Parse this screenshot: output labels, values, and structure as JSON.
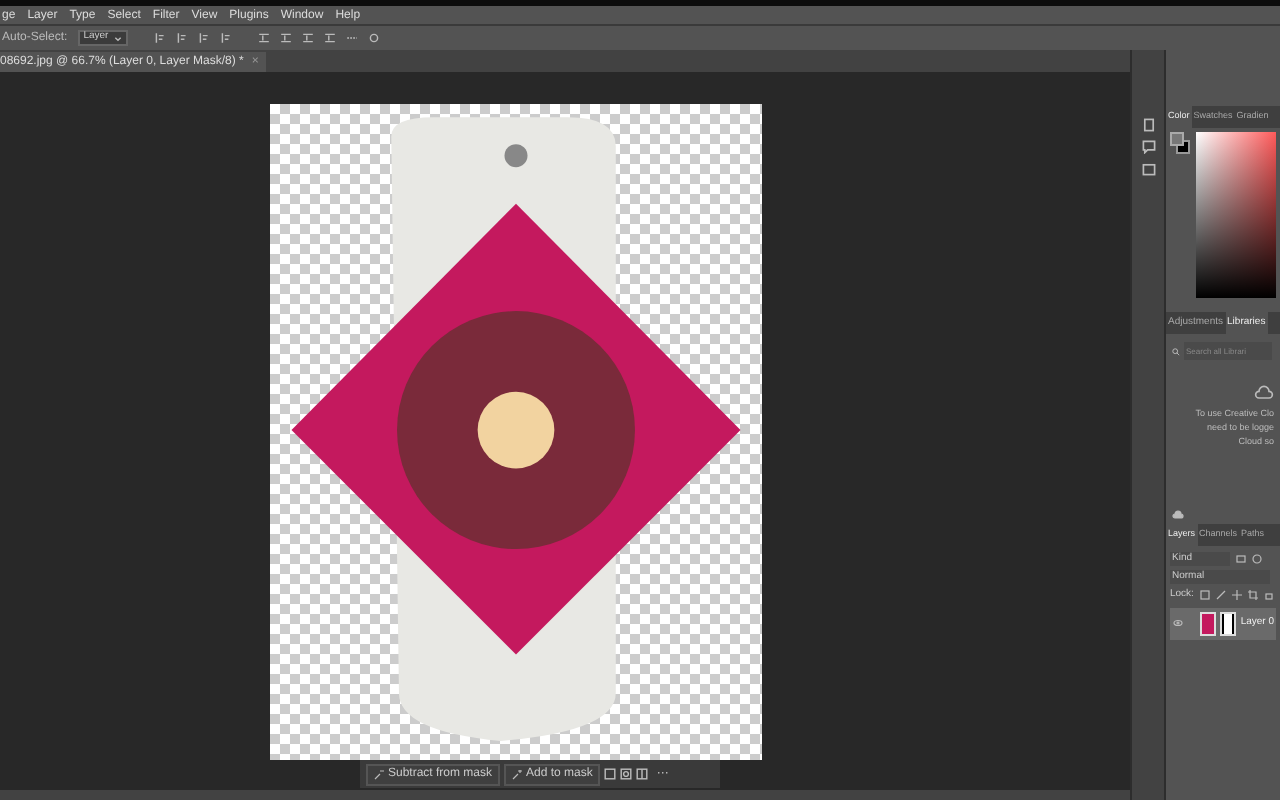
{
  "menu": [
    "ge",
    "Layer",
    "Type",
    "Select",
    "Filter",
    "View",
    "Plugins",
    "Window",
    "Help"
  ],
  "options_bar": {
    "label": "Auto-Select:",
    "dropdown": "Layer"
  },
  "document_tab": {
    "title": "08692.jpg @ 66.7% (Layer 0, Layer Mask/8) *",
    "close": "×"
  },
  "task_bar": {
    "buttons": [
      {
        "kind": "subtract",
        "label": "Subtract from mask"
      },
      {
        "kind": "add",
        "label": "Add to mask"
      }
    ],
    "more": "···"
  },
  "color_panel": {
    "tabs": [
      {
        "label": "Color",
        "selected": true
      },
      {
        "label": "Swatches",
        "selected": false
      },
      {
        "label": "Gradien",
        "selected": false
      }
    ]
  },
  "libraries_panel": {
    "tabs": [
      {
        "label": "Adjustments",
        "selected": false
      },
      {
        "label": "Libraries",
        "selected": true
      }
    ],
    "search": {
      "placeholder": "Search all Librari"
    },
    "message": [
      "To use Creative Clo",
      "need to be logge",
      "Cloud so"
    ]
  },
  "layers_panel": {
    "tabs": [
      {
        "label": "Layers",
        "selected": true
      },
      {
        "label": "Channels",
        "selected": false
      },
      {
        "label": "Paths",
        "selected": false
      }
    ],
    "filter": "Kind",
    "blend_mode": "Normal",
    "lock_label": "Lock:",
    "layers": [
      {
        "name": "Layer 0",
        "visible": true,
        "selected": true
      }
    ]
  }
}
